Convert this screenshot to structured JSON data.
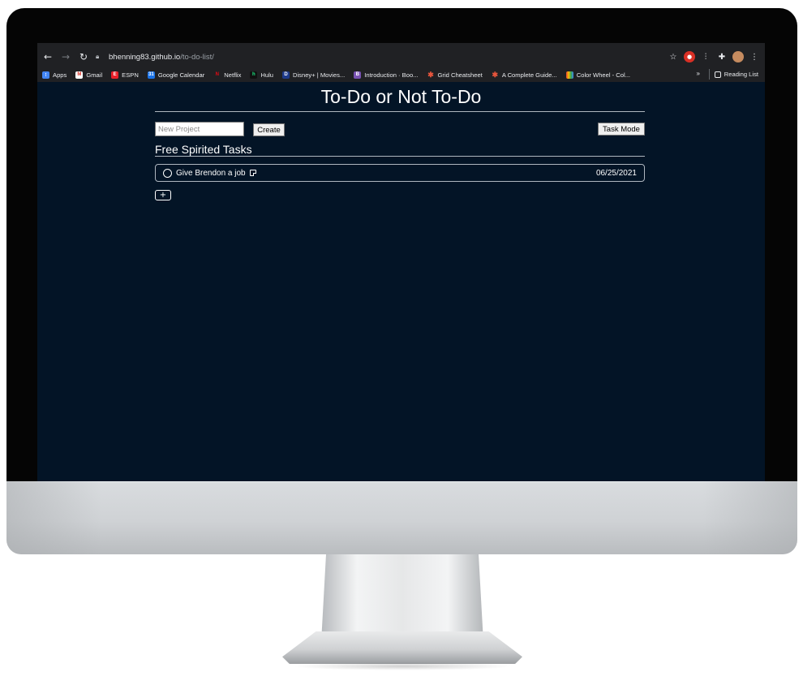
{
  "browser": {
    "url_host": "bhenning83.github.io",
    "url_path": "/to-do-list/",
    "bookmarks": [
      {
        "label": "Apps",
        "icon": "apps-grid-icon",
        "color": "#ea4335"
      },
      {
        "label": "Gmail",
        "icon": "gmail-icon",
        "color": "#d93025"
      },
      {
        "label": "ESPN",
        "icon": "espn-icon",
        "color": "#e8202a"
      },
      {
        "label": "Google Calendar",
        "icon": "google-calendar-icon",
        "color": "#1a73e8"
      },
      {
        "label": "Netflix",
        "icon": "netflix-icon",
        "color": "#e50914"
      },
      {
        "label": "Hulu",
        "icon": "hulu-icon",
        "color": "#1ce783"
      },
      {
        "label": "Disney+ | Movies...",
        "icon": "disney-plus-icon",
        "color": "#1e3a8a"
      },
      {
        "label": "Introduction · Boo...",
        "icon": "bootstrap-icon",
        "color": "#7952b3"
      },
      {
        "label": "Grid Cheatsheet",
        "icon": "asterisk-icon",
        "color": "#e8553c"
      },
      {
        "label": "A Complete Guide...",
        "icon": "asterisk-icon",
        "color": "#e8553c"
      },
      {
        "label": "Color Wheel - Col...",
        "icon": "color-wheel-icon",
        "color": "#f2b134"
      }
    ],
    "more": "»",
    "reading_list": "Reading List"
  },
  "app": {
    "title": "To-Do or Not To-Do",
    "new_project_placeholder": "New Project",
    "create_label": "Create",
    "mode_label": "Task Mode",
    "section_title": "Free Spirited Tasks",
    "tasks": [
      {
        "name": "Give Brendon a job",
        "date": "06/25/2021"
      }
    ],
    "add_label": "+"
  },
  "colors": {
    "page_background": "#031426",
    "text": "#ffffff",
    "divider": "#aeb6bf"
  }
}
